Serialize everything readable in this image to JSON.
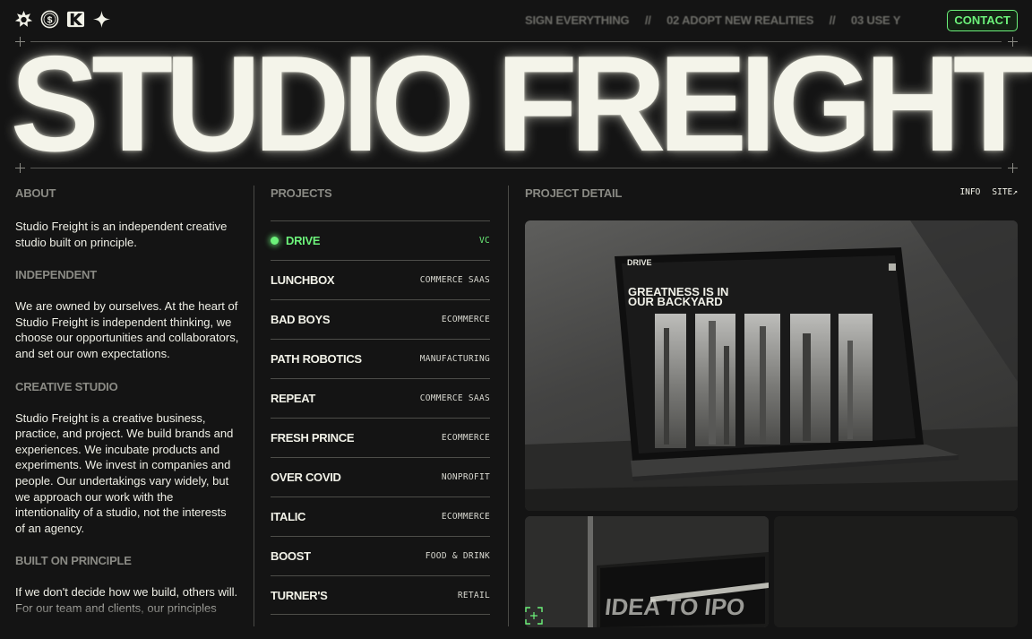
{
  "nav": {
    "marquee": [
      "SIGN EVERYTHING",
      "//",
      "02 ADOPT NEW REALITIES",
      "//",
      "03 USE Y"
    ],
    "contact_label": "CONTACT",
    "logos": [
      "star-badge-logo",
      "dollar-coin-logo",
      "k-mark-logo",
      "sparkle-logo"
    ]
  },
  "hero": {
    "title": "STUDIO FREIGHT"
  },
  "about": {
    "heading": "ABOUT",
    "intro": "Studio Freight is an independent creative studio built on principle.",
    "sections": [
      {
        "title": "INDEPENDENT",
        "body": "We are owned by ourselves. At the heart of Studio Freight is independent thinking, we choose our opportunities and collaborators, and set our own expectations."
      },
      {
        "title": "CREATIVE STUDIO",
        "body": "Studio Freight is a creative business, practice, and project. We build brands and experiences. We incubate products and experiments. We invest in companies and people. Our undertakings vary widely, but we approach our work with the intentionality of a studio, not the interests of an agency."
      },
      {
        "title": "BUILT ON PRINCIPLE",
        "body": "If we don't decide how we build, others will. For our team and clients, our principles"
      }
    ]
  },
  "projects": {
    "heading": "PROJECTS",
    "items": [
      {
        "name": "DRIVE",
        "tag": "VC",
        "active": true
      },
      {
        "name": "LUNCHBOX",
        "tag": "COMMERCE SAAS"
      },
      {
        "name": "BAD BOYS",
        "tag": "ECOMMERCE"
      },
      {
        "name": "PATH ROBOTICS",
        "tag": "MANUFACTURING"
      },
      {
        "name": "REPEAT",
        "tag": "COMMERCE SAAS"
      },
      {
        "name": "FRESH PRINCE",
        "tag": "ECOMMERCE"
      },
      {
        "name": "OVER COVID",
        "tag": "NONPROFIT"
      },
      {
        "name": "ITALIC",
        "tag": "ECOMMERCE"
      },
      {
        "name": "BOOST",
        "tag": "FOOD & DRINK"
      },
      {
        "name": "TURNER'S",
        "tag": "RETAIL"
      }
    ]
  },
  "detail": {
    "heading": "PROJECT DETAIL",
    "info_label": "INFO",
    "site_label": "SITE↗",
    "screen_logo": "DRIVE",
    "screen_headline_1": "GREATNESS IS IN",
    "screen_headline_2": "OUR BACKYARD",
    "screen_big": "DRIVE",
    "sign_text": "IDEA TO IPO"
  },
  "colors": {
    "accent": "#6cf27a",
    "background": "#141414",
    "text": "#efefe6",
    "muted": "#8a8a84"
  }
}
